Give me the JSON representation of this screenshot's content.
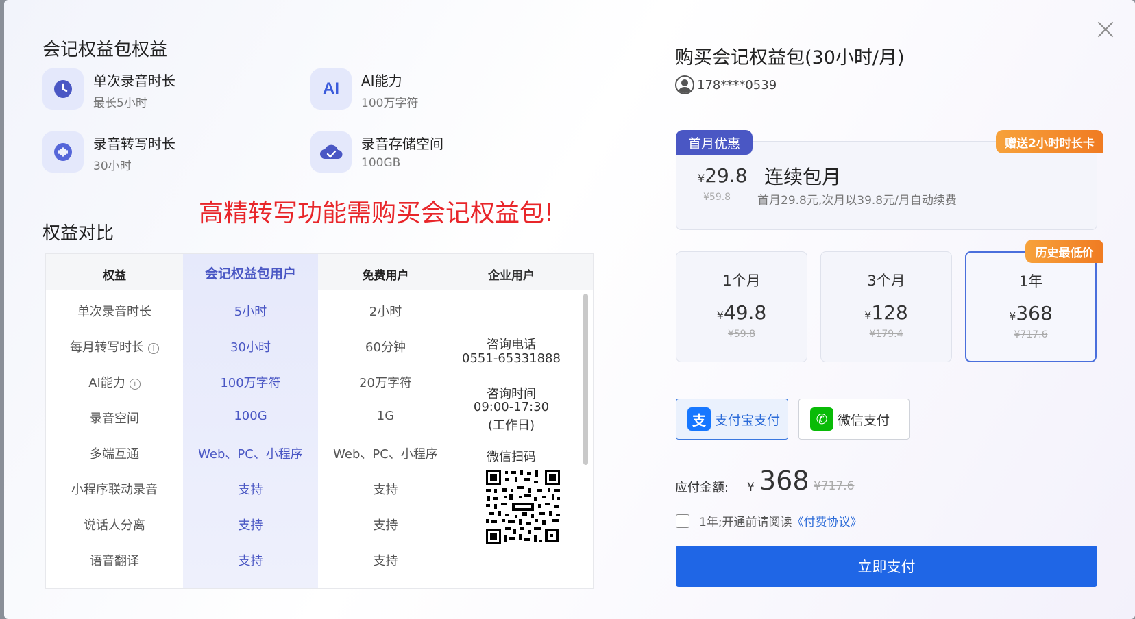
{
  "left": {
    "benefits_title": "会记权益包权益",
    "features": [
      {
        "title": "单次录音时长",
        "sub": "最长5小时",
        "icon": "clock-icon"
      },
      {
        "title": "AI能力",
        "sub": "100万字符",
        "icon": "ai-icon",
        "icon_text": "AI"
      },
      {
        "title": "录音转写时长",
        "sub": "30小时",
        "icon": "waveform-icon"
      },
      {
        "title": "录音存储空间",
        "sub": "100GB",
        "icon": "cloud-icon"
      }
    ],
    "promo_text": "高精转写功能需购买会记权益包!",
    "compare_title": "权益对比"
  },
  "table": {
    "headers": [
      "权益",
      "会记权益包用户",
      "免费用户",
      "企业用户"
    ],
    "rows": [
      [
        "单次录音时长",
        "5小时",
        "2小时"
      ],
      [
        "每月转写时长",
        "30小时",
        "60分钟"
      ],
      [
        "AI能力",
        "100万字符",
        "20万字符"
      ],
      [
        "录音空间",
        "100G",
        "1G"
      ],
      [
        "多端互通",
        "Web、PC、小程序",
        "Web、PC、小程序"
      ],
      [
        "小程序联动录音",
        "支持",
        "支持"
      ],
      [
        "说话人分离",
        "支持",
        "支持"
      ],
      [
        "语音翻译",
        "支持",
        "支持"
      ]
    ],
    "info_glyph": "i",
    "enterprise": {
      "phone_label": "咨询电话",
      "phone": "0551-65331888",
      "time_label": "咨询时间",
      "time": "09:00-17:30",
      "time_note": "(工作日)",
      "scan_label": "微信扫码"
    }
  },
  "right": {
    "title": "购买会记权益包(30小时/月)",
    "user_phone": "178****0539",
    "first_month_badge": "首月优惠",
    "gift_badge": "赠送2小时时长卡",
    "continuous": {
      "currency": "¥",
      "price": "29.8",
      "orig": "¥59.8",
      "name": "连续包月",
      "desc": "首月29.8元,次月以39.8元/月自动续费"
    },
    "lowest_badge": "历史最低价",
    "plans": [
      {
        "label": "1个月",
        "price": "49.8",
        "orig": "¥59.8"
      },
      {
        "label": "3个月",
        "price": "128",
        "orig": "¥179.4"
      },
      {
        "label": "1年",
        "price": "368",
        "orig": "¥717.6"
      }
    ],
    "selected_plan": 2,
    "pay_methods": [
      {
        "label": "支付宝支付",
        "icon": "alipay-icon",
        "glyph": "支",
        "color": "#1677ff"
      },
      {
        "label": "微信支付",
        "icon": "wechat-pay-icon",
        "glyph": "✆",
        "color": "#09bb07"
      }
    ],
    "total_label": "应付金额:",
    "total_currency": "¥",
    "total_value": "368",
    "total_orig": "¥717.6",
    "agree_text": "1年;开通前请阅读",
    "agree_link": "《付费协议》",
    "submit_label": "立即支付"
  }
}
